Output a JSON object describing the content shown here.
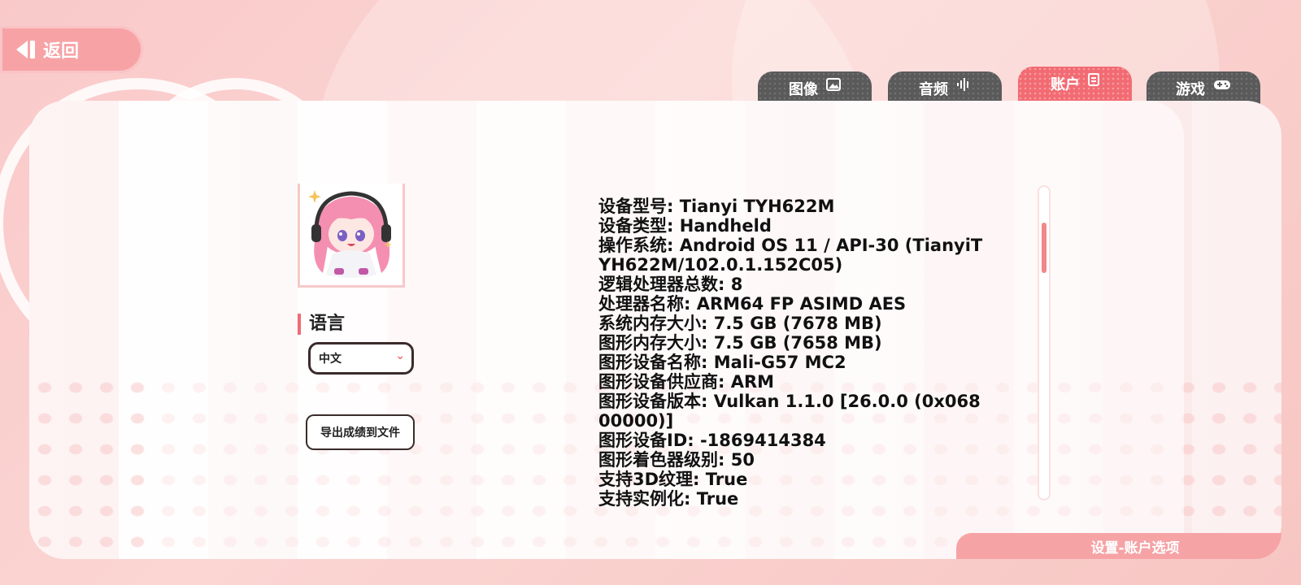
{
  "nav": {
    "back_label": "返回"
  },
  "tabs": [
    {
      "label": "图像",
      "icon": "image-icon"
    },
    {
      "label": "音频",
      "icon": "audio-icon"
    },
    {
      "label": "账户",
      "icon": "account-icon",
      "active": true
    },
    {
      "label": "游戏",
      "icon": "gamepad-icon"
    }
  ],
  "language": {
    "title": "语言",
    "selected": "中文"
  },
  "export_button_label": "导出成绩到文件",
  "device_info": [
    "设备型号: Tianyi TYH622M",
    "设备类型: Handheld",
    "操作系统: Android OS 11 / API-30 (TianyiTYH622M/102.0.1.152C05)",
    "逻辑处理器总数: 8",
    "处理器名称: ARM64 FP ASIMD AES",
    "系统内存大小: 7.5 GB (7678 MB)",
    "图形内存大小: 7.5 GB (7658 MB)",
    "图形设备名称: Mali-G57 MC2",
    "图形设备供应商: ARM",
    "图形设备版本: Vulkan 1.1.0 [26.0.0 (0x06800000)]",
    "图形设备ID: -1869414384",
    "图形着色器级别: 50",
    "支持3D纹理: True",
    "支持实例化: True"
  ],
  "footer_label": "设置-账户选项",
  "colors": {
    "accent": "#f06c74",
    "tab_dark": "#5a5a5a",
    "panel_bg": "#ffffff"
  }
}
